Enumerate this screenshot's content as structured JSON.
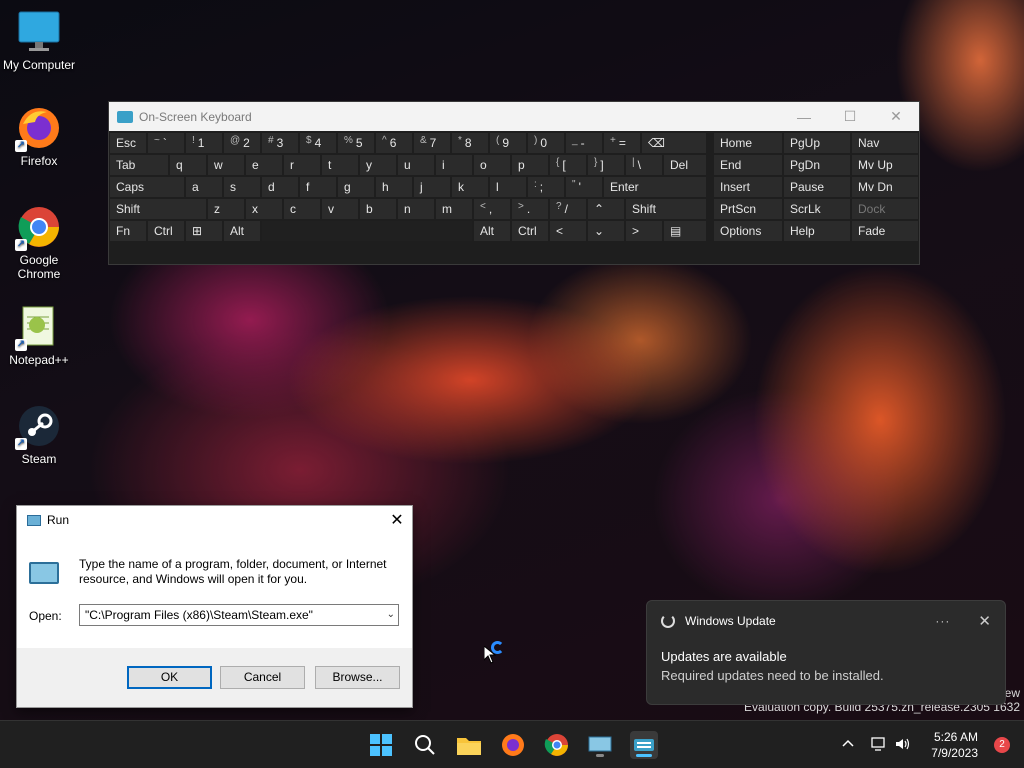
{
  "desktop": {
    "icons": [
      {
        "label": "My Computer",
        "icon": "monitor-icon"
      },
      {
        "label": "Firefox",
        "icon": "firefox-icon"
      },
      {
        "label": "Google Chrome",
        "icon": "chrome-icon"
      },
      {
        "label": "Notepad++",
        "icon": "notepadpp-icon"
      },
      {
        "label": "Steam",
        "icon": "steam-icon"
      }
    ]
  },
  "osk": {
    "title": "On-Screen Keyboard",
    "rows": [
      [
        {
          "label": "Esc"
        },
        {
          "top": "~",
          "label": "`"
        },
        {
          "top": "!",
          "label": "1"
        },
        {
          "top": "@",
          "label": "2"
        },
        {
          "top": "#",
          "label": "3"
        },
        {
          "top": "$",
          "label": "4"
        },
        {
          "top": "%",
          "label": "5"
        },
        {
          "top": "^",
          "label": "6"
        },
        {
          "top": "&",
          "label": "7"
        },
        {
          "top": "*",
          "label": "8"
        },
        {
          "top": "(",
          "label": "9"
        },
        {
          "top": ")",
          "label": "0"
        },
        {
          "top": "_",
          "label": "-"
        },
        {
          "top": "+",
          "label": "="
        },
        {
          "label": "⌫"
        }
      ],
      [
        {
          "label": "Tab"
        },
        {
          "label": "q"
        },
        {
          "label": "w"
        },
        {
          "label": "e"
        },
        {
          "label": "r"
        },
        {
          "label": "t"
        },
        {
          "label": "y"
        },
        {
          "label": "u"
        },
        {
          "label": "i"
        },
        {
          "label": "o"
        },
        {
          "label": "p"
        },
        {
          "top": "{",
          "label": "["
        },
        {
          "top": "}",
          "label": "]"
        },
        {
          "top": "|",
          "label": "\\"
        },
        {
          "label": "Del"
        }
      ],
      [
        {
          "label": "Caps"
        },
        {
          "label": "a"
        },
        {
          "label": "s"
        },
        {
          "label": "d"
        },
        {
          "label": "f"
        },
        {
          "label": "g"
        },
        {
          "label": "h"
        },
        {
          "label": "j"
        },
        {
          "label": "k"
        },
        {
          "label": "l"
        },
        {
          "top": ":",
          "label": ";"
        },
        {
          "top": "\"",
          "label": "'"
        },
        {
          "label": "Enter"
        }
      ],
      [
        {
          "label": "Shift"
        },
        {
          "label": "z"
        },
        {
          "label": "x"
        },
        {
          "label": "c"
        },
        {
          "label": "v"
        },
        {
          "label": "b"
        },
        {
          "label": "n"
        },
        {
          "label": "m"
        },
        {
          "top": "<",
          "label": ","
        },
        {
          "top": ">",
          "label": "."
        },
        {
          "top": "?",
          "label": "/"
        },
        {
          "label": "⌃"
        },
        {
          "label": "Shift"
        }
      ],
      [
        {
          "label": "Fn"
        },
        {
          "label": "Ctrl"
        },
        {
          "label": "⊞"
        },
        {
          "label": "Alt"
        },
        {
          "label": ""
        },
        {
          "label": "Alt"
        },
        {
          "label": "Ctrl"
        },
        {
          "label": "<"
        },
        {
          "label": "⌄"
        },
        {
          "label": ">"
        },
        {
          "label": "▤"
        }
      ]
    ],
    "nav_rows": [
      [
        "Home",
        "PgUp",
        "Nav"
      ],
      [
        "End",
        "PgDn",
        "Mv Up"
      ],
      [
        "Insert",
        "Pause",
        "Mv Dn"
      ],
      [
        "PrtScn",
        "ScrLk",
        "Dock"
      ],
      [
        "Options",
        "Help",
        "Fade"
      ]
    ]
  },
  "run": {
    "title": "Run",
    "description": "Type the name of a program, folder, document, or Internet resource, and Windows will open it for you.",
    "open_label": "Open:",
    "open_value": "\"C:\\Program Files (x86)\\Steam\\Steam.exe\"",
    "ok": "OK",
    "cancel": "Cancel",
    "browse": "Browse..."
  },
  "toast": {
    "app": "Windows Update",
    "more": "···",
    "title": "Updates are available",
    "body": "Required updates need to be installed."
  },
  "watermark": {
    "line1": "ew",
    "line2": "Evaluation copy. Build 25375.zn_release.2305   1632"
  },
  "taskbar": {
    "time": "5:26 AM",
    "date": "7/9/2023",
    "notifications": "2"
  }
}
